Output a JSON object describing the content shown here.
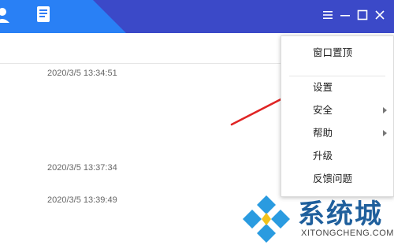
{
  "titlebar": {
    "icons": [
      "user-icon",
      "document-icon"
    ],
    "window_controls": [
      "menu-icon",
      "minimize-icon",
      "maximize-icon",
      "close-icon"
    ]
  },
  "list": {
    "timestamps": [
      "2020/3/5 13:34:51",
      "2020/3/5 13:37:34",
      "2020/3/5 13:39:49"
    ]
  },
  "menu": {
    "items": [
      {
        "label": "窗口置顶",
        "has_submenu": false
      },
      {
        "label": "设置",
        "has_submenu": false
      },
      {
        "label": "安全",
        "has_submenu": true
      },
      {
        "label": "帮助",
        "has_submenu": true
      },
      {
        "label": "升级",
        "has_submenu": false
      },
      {
        "label": "反馈问题",
        "has_submenu": false
      }
    ]
  },
  "watermark": {
    "title": "系统城",
    "subtitle": "XITONGCHENG.COM"
  },
  "colors": {
    "titlebar_blue": "#2f7cf6",
    "titlebar_dark": "#3b49c8",
    "arrow_red": "#e02424",
    "watermark_blue": "#1f5f9c"
  }
}
